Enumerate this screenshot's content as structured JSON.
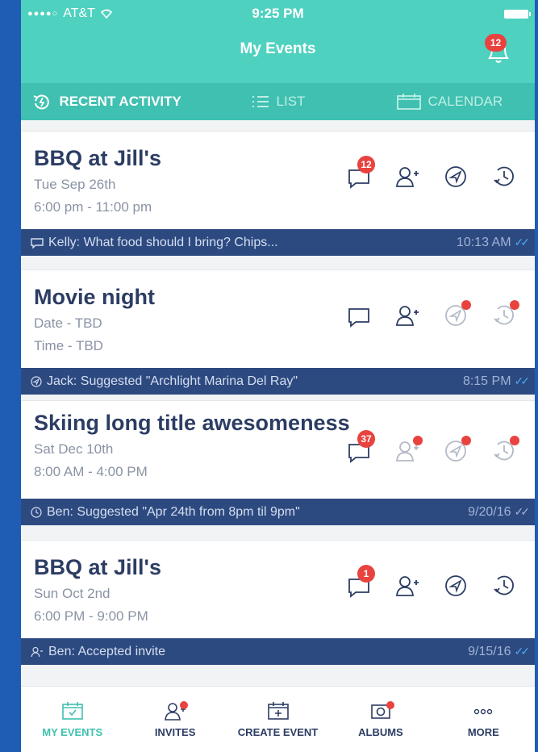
{
  "status": {
    "carrier": "AT&T",
    "signal": "●●●●○",
    "time": "9:25 PM"
  },
  "header": {
    "title": "My Events",
    "notifications": "12"
  },
  "tabs": [
    {
      "label": "RECENT ACTIVITY",
      "icon": "recent-activity-icon"
    },
    {
      "label": "LIST",
      "icon": "list-icon"
    },
    {
      "label": "CALENDAR",
      "icon": "calendar-icon"
    }
  ],
  "events": [
    {
      "title": "BBQ at Jill's",
      "line1": "Tue Sep 26th",
      "line2": "6:00 pm - 11:00 pm",
      "chat_badge": "12",
      "activity": {
        "text": "Kelly: What food should I bring? Chips...",
        "time": "10:13 AM"
      }
    },
    {
      "title": "Movie night",
      "line1": "Date - TBD",
      "line2": "Time - TBD",
      "chat_badge": "",
      "activity": {
        "text": "Jack: Suggested \"Archlight Marina Del Ray\"",
        "time": "8:15 PM"
      }
    },
    {
      "title": "Skiing long title awesomeness",
      "line1": "Sat Dec 10th",
      "line2": "8:00 AM - 4:00 PM",
      "chat_badge": "37",
      "activity": {
        "text": "Ben: Suggested \"Apr 24th from 8pm til 9pm\"",
        "time": "9/20/16"
      }
    },
    {
      "title": "BBQ at Jill's",
      "line1": "Sun Oct 2nd",
      "line2": "6:00 PM - 9:00 PM",
      "chat_badge": "1",
      "activity": {
        "text": "Ben: Accepted invite",
        "time": "9/15/16"
      }
    }
  ],
  "bottom_nav": [
    {
      "label": "MY EVENTS"
    },
    {
      "label": "INVITES"
    },
    {
      "label": "CREATE EVENT"
    },
    {
      "label": "ALBUMS"
    },
    {
      "label": "MORE"
    }
  ],
  "colors": {
    "teal": "#4fd1c0",
    "navy": "#2c3d64",
    "activity_bar": "#2d4a80",
    "badge_red": "#e8433f"
  }
}
